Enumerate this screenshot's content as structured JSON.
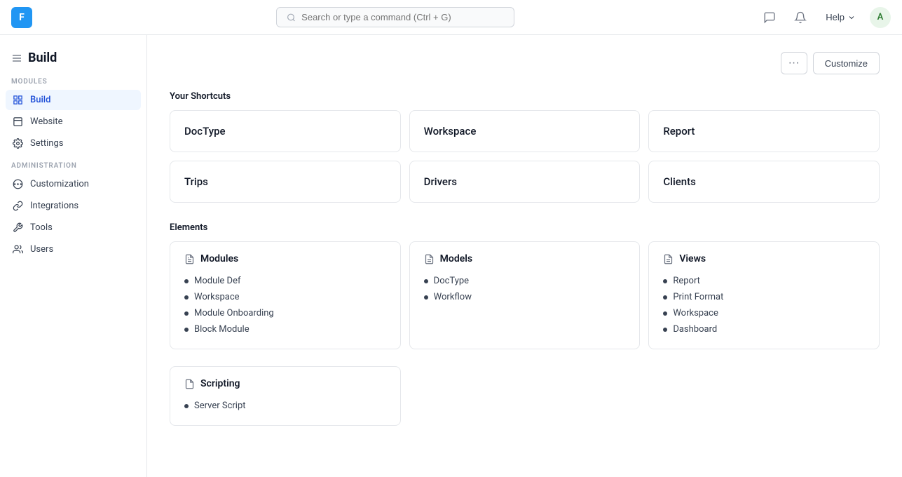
{
  "app": {
    "logo": "F",
    "search_placeholder": "Search or type a command (Ctrl + G)"
  },
  "topnav": {
    "help_label": "Help",
    "avatar_label": "A",
    "chat_icon": "💬",
    "bell_icon": "🔔"
  },
  "page": {
    "title": "Build",
    "customize_label": "Customize"
  },
  "sidebar": {
    "modules_label": "MODULES",
    "administration_label": "ADMINISTRATION",
    "items_modules": [
      {
        "id": "build",
        "label": "Build",
        "active": true
      },
      {
        "id": "website",
        "label": "Website",
        "active": false
      },
      {
        "id": "settings",
        "label": "Settings",
        "active": false
      }
    ],
    "items_admin": [
      {
        "id": "customization",
        "label": "Customization"
      },
      {
        "id": "integrations",
        "label": "Integrations"
      },
      {
        "id": "tools",
        "label": "Tools"
      },
      {
        "id": "users",
        "label": "Users"
      }
    ]
  },
  "shortcuts": {
    "section_label": "Your Shortcuts",
    "items": [
      {
        "label": "DocType"
      },
      {
        "label": "Workspace"
      },
      {
        "label": "Report"
      },
      {
        "label": "Trips"
      },
      {
        "label": "Drivers"
      },
      {
        "label": "Clients"
      }
    ]
  },
  "elements": {
    "section_label": "Elements",
    "cards": [
      {
        "id": "modules",
        "title": "Modules",
        "items": [
          "Module Def",
          "Workspace",
          "Module Onboarding",
          "Block Module"
        ]
      },
      {
        "id": "models",
        "title": "Models",
        "items": [
          "DocType",
          "Workflow"
        ]
      },
      {
        "id": "views",
        "title": "Views",
        "items": [
          "Report",
          "Print Format",
          "Workspace",
          "Dashboard"
        ]
      }
    ],
    "scripting_card": {
      "title": "Scripting",
      "items": [
        "Server Script"
      ]
    }
  }
}
